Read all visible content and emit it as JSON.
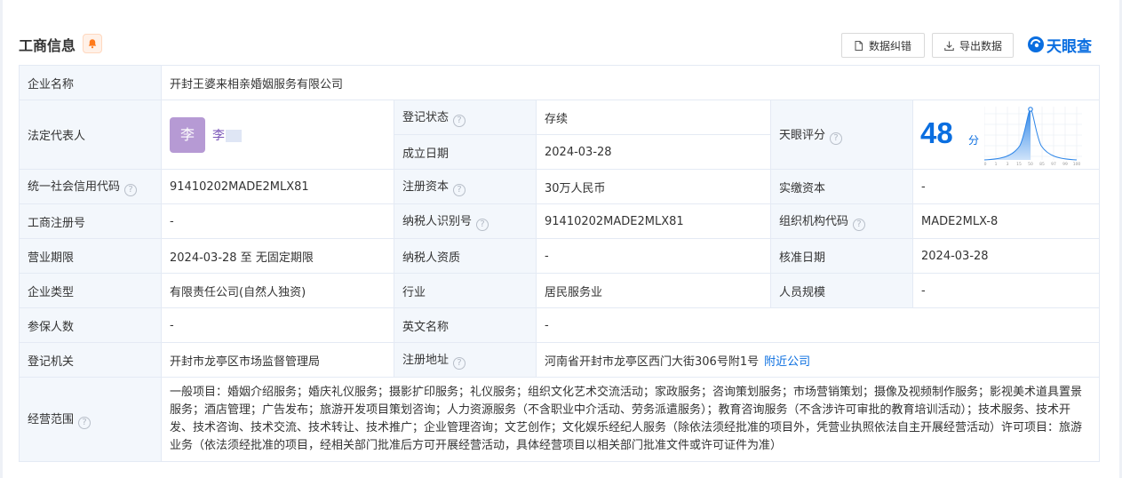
{
  "header": {
    "title": "工商信息",
    "correct_label": "数据纠错",
    "export_label": "导出数据",
    "logo_text": "天眼查",
    "brand_color": "#0a6ee0"
  },
  "company": {
    "name_label": "企业名称",
    "name": "开封王婆来相亲婚姻服务有限公司",
    "legal_rep_label": "法定代表人",
    "legal_rep_avatar": "李",
    "legal_rep_name": "李",
    "reg_status_label": "登记状态",
    "reg_status": "存续",
    "founded_label": "成立日期",
    "founded": "2024-03-28",
    "score_label": "天眼评分",
    "score": "48",
    "score_unit": "分",
    "score_axis": [
      "0",
      "1",
      "3",
      "15",
      "50",
      "85",
      "97",
      "99",
      "100"
    ],
    "credit_code_label": "统一社会信用代码",
    "credit_code": "91410202MADE2MLX81",
    "reg_capital_label": "注册资本",
    "reg_capital": "30万人民币",
    "paid_capital_label": "实缴资本",
    "paid_capital": "-",
    "reg_no_label": "工商注册号",
    "reg_no": "-",
    "taxpayer_id_label": "纳税人识别号",
    "taxpayer_id": "91410202MADE2MLX81",
    "org_code_label": "组织机构代码",
    "org_code": "MADE2MLX-8",
    "term_label": "营业期限",
    "term": "2024-03-28 至 无固定期限",
    "taxpayer_qual_label": "纳税人资质",
    "taxpayer_qual": "-",
    "approval_date_label": "核准日期",
    "approval_date": "2024-03-28",
    "type_label": "企业类型",
    "type": "有限责任公司(自然人独资)",
    "industry_label": "行业",
    "industry": "居民服务业",
    "staff_size_label": "人员规模",
    "staff_size": "-",
    "insured_label": "参保人数",
    "insured": "-",
    "english_name_label": "英文名称",
    "english_name": "-",
    "authority_label": "登记机关",
    "authority": "开封市龙亭区市场监督管理局",
    "address_label": "注册地址",
    "address": "河南省开封市龙亭区西门大街306号附1号",
    "nearby_link": "附近公司",
    "scope_label": "经营范围",
    "scope": "一般项目：婚姻介绍服务；婚庆礼仪服务；摄影扩印服务；礼仪服务；组织文化艺术交流活动；家政服务；咨询策划服务；市场营销策划；摄像及视频制作服务；影视美术道具置景服务；酒店管理；广告发布；旅游开发项目策划咨询；人力资源服务（不含职业中介活动、劳务派遣服务）；教育咨询服务（不含涉许可审批的教育培训活动）；技术服务、技术开发、技术咨询、技术交流、技术转让、技术推广；企业管理咨询；文艺创作；文化娱乐经纪人服务（除依法须经批准的项目外，凭营业执照依法自主开展经营活动）许可项目：旅游业务（依法须经批准的项目，经相关部门批准后方可开展经营活动，具体经营项目以相关部门批准文件或许可证件为准）"
  }
}
